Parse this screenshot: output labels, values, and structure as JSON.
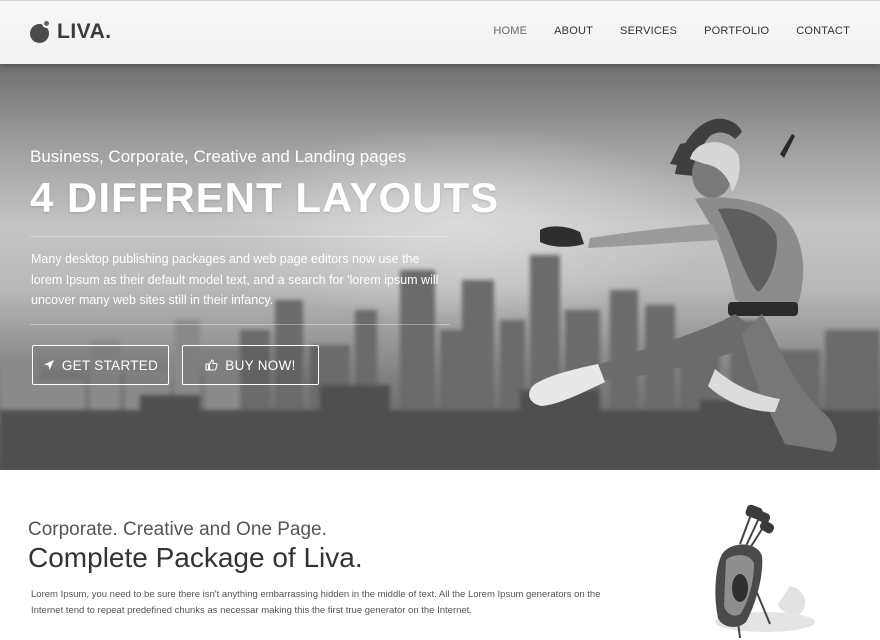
{
  "header": {
    "logo_text": "LIVA.",
    "nav": [
      {
        "label": "HOME",
        "active": true
      },
      {
        "label": "ABOUT",
        "active": false
      },
      {
        "label": "SERVICES",
        "active": false
      },
      {
        "label": "PORTFOLIO",
        "active": false
      },
      {
        "label": "CONTACT",
        "active": false
      }
    ]
  },
  "hero": {
    "subtitle": "Business, Corporate, Creative and Landing pages",
    "title": "4 DIFFRENT LAYOUTS",
    "description": "Many desktop publishing packages and web page editors now use the lorem Ipsum as their default model text, and a search for 'lorem ipsum will uncover many web sites still in their infancy.",
    "buttons": {
      "get_started": {
        "label": "GET STARTED",
        "icon": "location-arrow-icon"
      },
      "buy_now": {
        "label": "BUY NOW!",
        "icon": "thumbs-up-icon"
      }
    }
  },
  "section": {
    "tagline": "Corporate. Creative and One Page.",
    "headline": "Complete Package of Liva.",
    "body": "Lorem Ipsum, you need to be sure there isn't anything embarrassing hidden in the middle of text. All the Lorem Ipsum generators on the Internet tend to repeat predefined chunks as necessar making this the first true generator on the Internet."
  },
  "colors": {
    "header_bg": "#f4f4f4",
    "text_dark": "#333333",
    "hero_text": "#ffffff"
  }
}
